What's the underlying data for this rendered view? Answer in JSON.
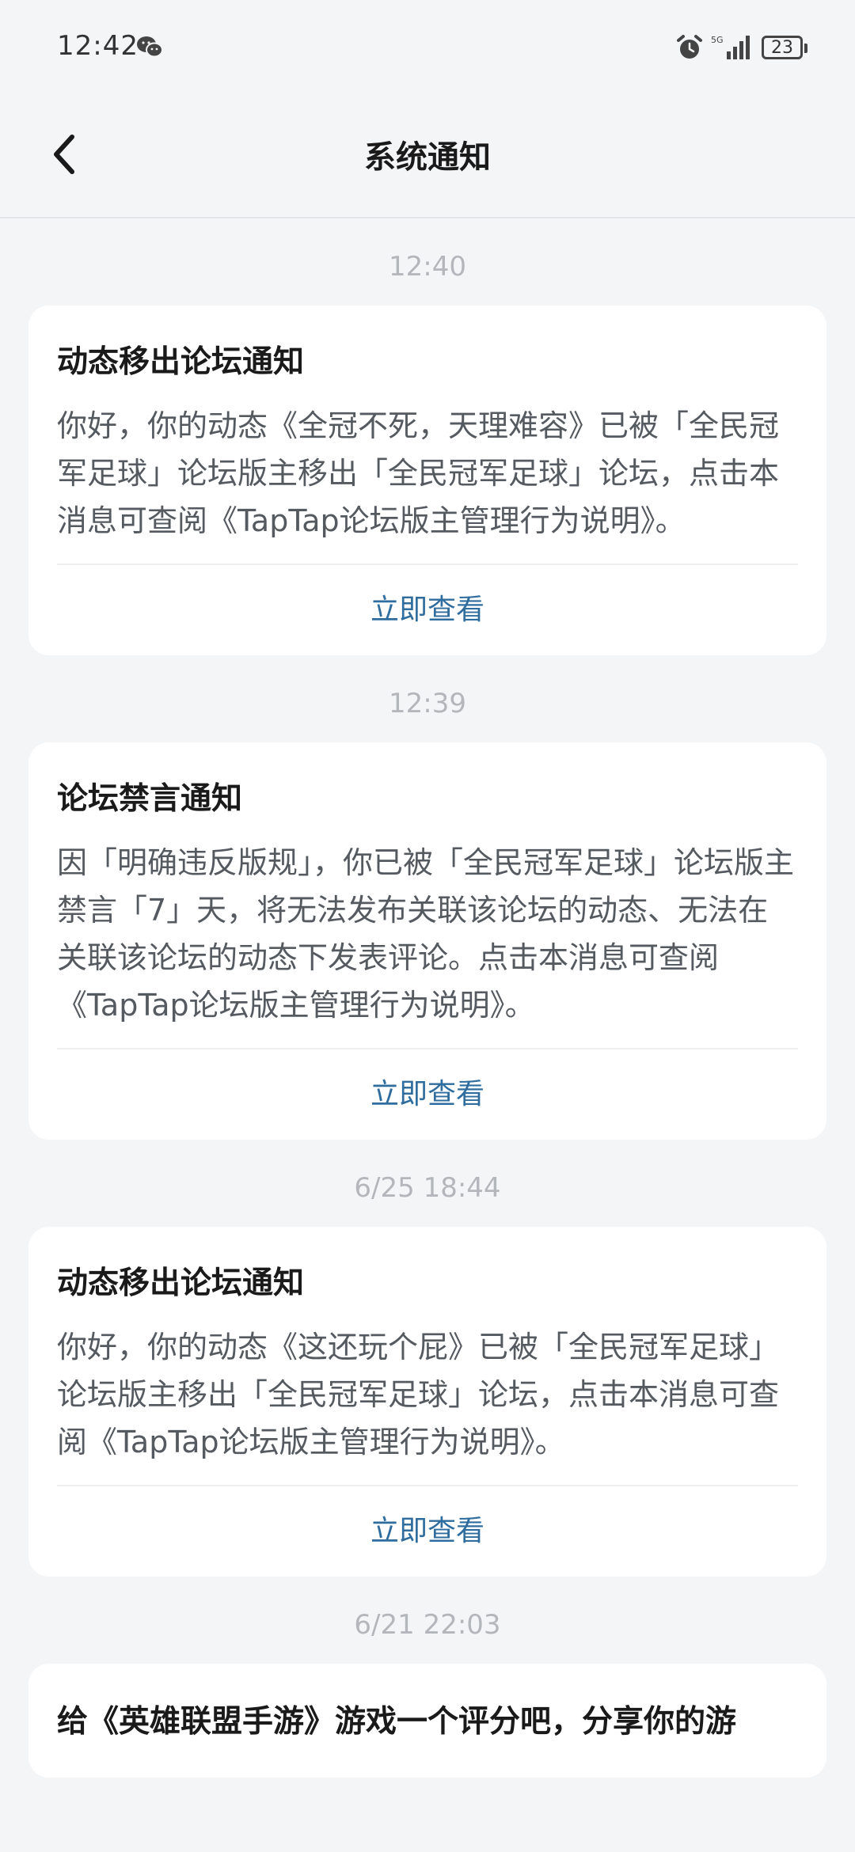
{
  "status_bar": {
    "time": "12:42",
    "network": "5G",
    "battery": "23"
  },
  "header": {
    "title": "系统通知"
  },
  "notifications": [
    {
      "time": "12:40",
      "title": "动态移出论坛通知",
      "body": "你好，你的动态《全冠不死，天理难容》已被「全民冠军足球」论坛版主移出「全民冠军足球」论坛，点击本消息可查阅《TapTap论坛版主管理行为说明》。",
      "action": "立即查看"
    },
    {
      "time": "12:39",
      "title": "论坛禁言通知",
      "body": "因「明确违反版规」，你已被「全民冠军足球」论坛版主禁言「7」天，将无法发布关联该论坛的动态、无法在关联该论坛的动态下发表评论。点击本消息可查阅《TapTap论坛版主管理行为说明》。",
      "action": "立即查看"
    },
    {
      "time": "6/25  18:44",
      "title": "动态移出论坛通知",
      "body": "你好，你的动态《这还玩个屁》已被「全民冠军足球」论坛版主移出「全民冠军足球」论坛，点击本消息可查阅《TapTap论坛版主管理行为说明》。",
      "action": "立即查看"
    },
    {
      "time": "6/21  22:03",
      "title": "给《英雄联盟手游》游戏一个评分吧，分享你的游"
    }
  ]
}
